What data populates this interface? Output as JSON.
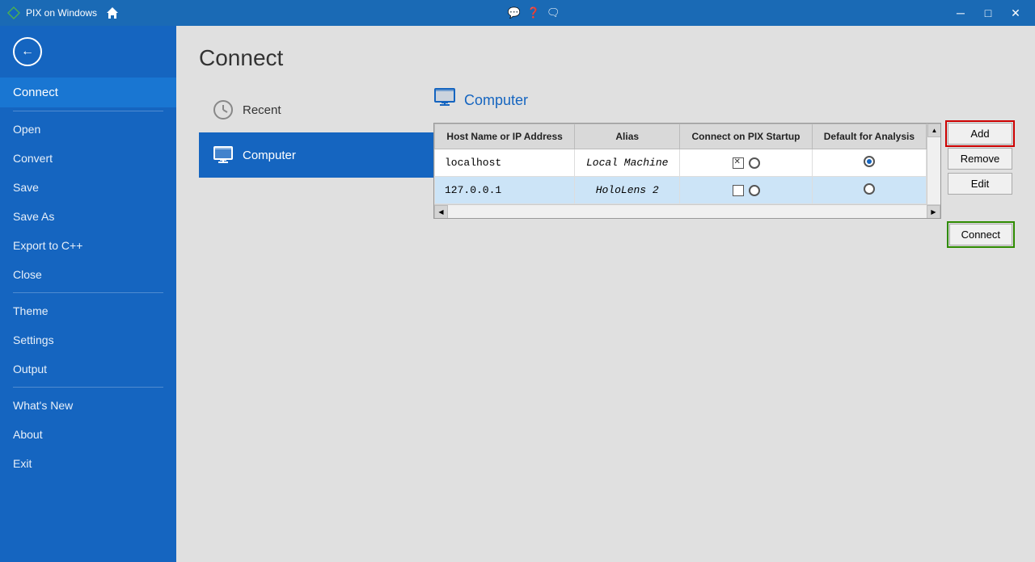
{
  "app": {
    "title": "PIX on Windows",
    "icon": "🏠"
  },
  "titlebar": {
    "icons": [
      "💬",
      "❓",
      "💬"
    ],
    "minimize": "─",
    "maximize": "□",
    "close": "✕"
  },
  "sidebar": {
    "back_label": "",
    "active_item": "Connect",
    "items": [
      {
        "id": "open",
        "label": "Open"
      },
      {
        "id": "convert",
        "label": "Convert"
      },
      {
        "id": "save",
        "label": "Save"
      },
      {
        "id": "save-as",
        "label": "Save As"
      },
      {
        "id": "export",
        "label": "Export to C++"
      },
      {
        "id": "close",
        "label": "Close"
      },
      {
        "id": "theme",
        "label": "Theme"
      },
      {
        "id": "settings",
        "label": "Settings"
      },
      {
        "id": "output",
        "label": "Output"
      },
      {
        "id": "whats-new",
        "label": "What's New"
      },
      {
        "id": "about",
        "label": "About"
      },
      {
        "id": "exit",
        "label": "Exit"
      }
    ]
  },
  "page": {
    "title": "Connect"
  },
  "nav": {
    "recent_label": "Recent",
    "computer_label": "Computer"
  },
  "computer_section": {
    "title": "Computer",
    "columns": {
      "host": "Host Name or IP Address",
      "alias": "Alias",
      "connect_on_startup": "Connect on PIX Startup",
      "default_analysis": "Default for Analysis"
    },
    "rows": [
      {
        "host": "localhost",
        "alias": "Local Machine",
        "connect_on_startup_checked": true,
        "connect_on_startup_radio": false,
        "default_radio": true,
        "selected": false
      },
      {
        "host": "127.0.0.1",
        "alias": "HoloLens 2",
        "connect_on_startup_checked": false,
        "connect_on_startup_radio": false,
        "default_radio": false,
        "selected": true
      }
    ],
    "buttons": {
      "add": "Add",
      "remove": "Remove",
      "edit": "Edit",
      "connect": "Connect"
    }
  }
}
